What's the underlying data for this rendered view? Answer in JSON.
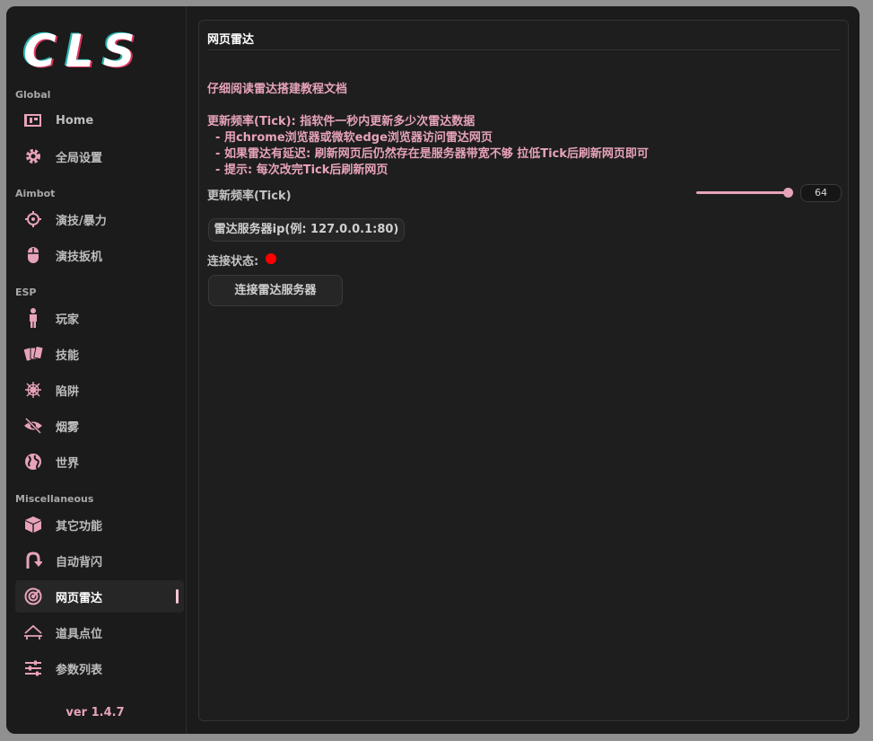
{
  "app": {
    "logo_text": "CLS",
    "version": "ver 1.4.7",
    "accent_color": "#e7a3b8"
  },
  "sidebar": {
    "sections": [
      "Global",
      "Aimbot",
      "ESP",
      "Miscellaneous"
    ],
    "items": [
      {
        "label": "Home",
        "icon": "home-icon"
      },
      {
        "label": "全局设置",
        "icon": "gear-icon"
      },
      {
        "label": "演技/暴力",
        "icon": "crosshair-icon"
      },
      {
        "label": "演技扳机",
        "icon": "mouse-icon"
      },
      {
        "label": "玩家",
        "icon": "person-icon"
      },
      {
        "label": "技能",
        "icon": "cards-icon"
      },
      {
        "label": "陷阱",
        "icon": "spiderweb-icon"
      },
      {
        "label": "烟雾",
        "icon": "eye-slash-icon"
      },
      {
        "label": "世界",
        "icon": "globe-icon"
      },
      {
        "label": "其它功能",
        "icon": "cube-icon"
      },
      {
        "label": "自动背闪",
        "icon": "u-turn-icon"
      },
      {
        "label": "网页雷达",
        "icon": "radar-icon",
        "active": true
      },
      {
        "label": "道具点位",
        "icon": "map-marker-icon"
      },
      {
        "label": "参数列表",
        "icon": "sliders-icon"
      }
    ]
  },
  "panel": {
    "title": "网页雷达",
    "doc_hint": "仔细阅读雷达搭建教程文档",
    "info_lines": [
      "更新频率(Tick): 指软件一秒内更新多少次雷达数据",
      "  - 用chrome浏览器或微软edge浏览器访问雷达网页",
      "  - 如果雷达有延迟: 刷新网页后仍然存在是服务器带宽不够 拉低Tick后刷新网页即可",
      "  - 提示: 每次改完Tick后刷新网页"
    ],
    "tick_label": "更新频率(Tick)",
    "tick_value": "64",
    "tick_fill_fraction": 0.95,
    "server_ip_placeholder": "雷达服务器ip(例: 127.0.0.1:80)",
    "status_label": "连接状态:",
    "status_color": "#ff0000",
    "connect_button": "连接雷达服务器"
  }
}
